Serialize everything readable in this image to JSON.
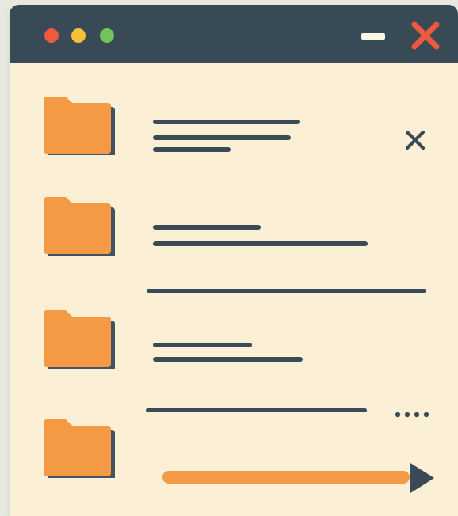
{
  "window": {
    "controls": {
      "traffic_lights": [
        "red",
        "yellow",
        "green"
      ],
      "minimize_icon": "minimize-icon",
      "close_icon": "close-icon"
    },
    "accent_colors": {
      "titlebar": "#384a56",
      "background": "#fbf0d6",
      "folder": "#f49a45",
      "close": "#ef5a3e"
    }
  },
  "list": {
    "items": [
      {
        "icon": "folder-icon",
        "action_icon": "close-icon"
      },
      {
        "icon": "folder-icon"
      },
      {
        "icon": "folder-icon",
        "action_icon": "more-icon"
      },
      {
        "icon": "folder-icon",
        "progress": 0.95,
        "action_icon": "play-icon"
      }
    ]
  }
}
